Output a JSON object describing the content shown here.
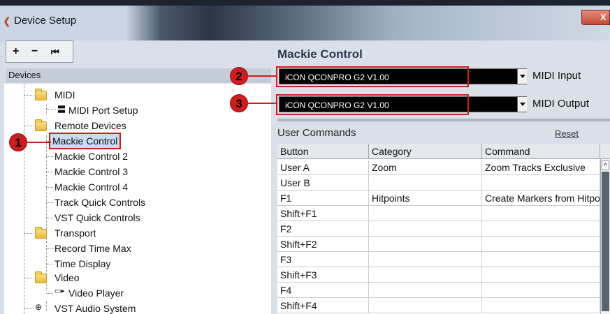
{
  "window": {
    "title": "Device Setup",
    "close_label": "X"
  },
  "toolbar": {
    "add_label": "+",
    "remove_label": "−",
    "reset_label": "⏮"
  },
  "devices": {
    "header": "Devices",
    "items": [
      {
        "label": "MIDI",
        "type": "folder"
      },
      {
        "label": "MIDI Port Setup",
        "type": "item"
      },
      {
        "label": "Remote Devices",
        "type": "folder"
      },
      {
        "label": "Mackie Control",
        "type": "item",
        "selected": true
      },
      {
        "label": "Mackie Control 2",
        "type": "item"
      },
      {
        "label": "Mackie Control 3",
        "type": "item"
      },
      {
        "label": "Mackie Control 4",
        "type": "item"
      },
      {
        "label": "Track Quick Controls",
        "type": "item"
      },
      {
        "label": "VST Quick Controls",
        "type": "item"
      },
      {
        "label": "Transport",
        "type": "folder"
      },
      {
        "label": "Record Time Max",
        "type": "item"
      },
      {
        "label": "Time Display",
        "type": "item"
      },
      {
        "label": "Video",
        "type": "folder"
      },
      {
        "label": "Video Player",
        "type": "item"
      },
      {
        "label": "VST Audio System",
        "type": "item"
      }
    ]
  },
  "callouts": [
    "1",
    "2",
    "3"
  ],
  "panel": {
    "title": "Mackie Control",
    "midi_input_value": "iCON QCONPRO G2 V1.00",
    "midi_input_label": "MIDI Input",
    "midi_output_value": "iCON QCONPRO G2 V1.00",
    "midi_output_label": "MIDI Output",
    "user_commands_label": "User Commands",
    "reset_label": "Reset"
  },
  "commands_table": {
    "columns": [
      "Button",
      "Category",
      "Command"
    ],
    "rows": [
      [
        "User A",
        "Zoom",
        "Zoom Tracks Exclusive"
      ],
      [
        "User B",
        "",
        ""
      ],
      [
        "F1",
        "Hitpoints",
        "Create Markers from Hitpoints"
      ],
      [
        "Shift+F1",
        "",
        ""
      ],
      [
        "F2",
        "",
        ""
      ],
      [
        "Shift+F2",
        "",
        ""
      ],
      [
        "F3",
        "",
        ""
      ],
      [
        "Shift+F3",
        "",
        ""
      ],
      [
        "F4",
        "",
        ""
      ],
      [
        "Shift+F4",
        "",
        ""
      ]
    ]
  },
  "colors": {
    "callout_red": "#d01c1c",
    "selection_bg": "#c9dcf0",
    "dropdown_bg": "#000000"
  }
}
